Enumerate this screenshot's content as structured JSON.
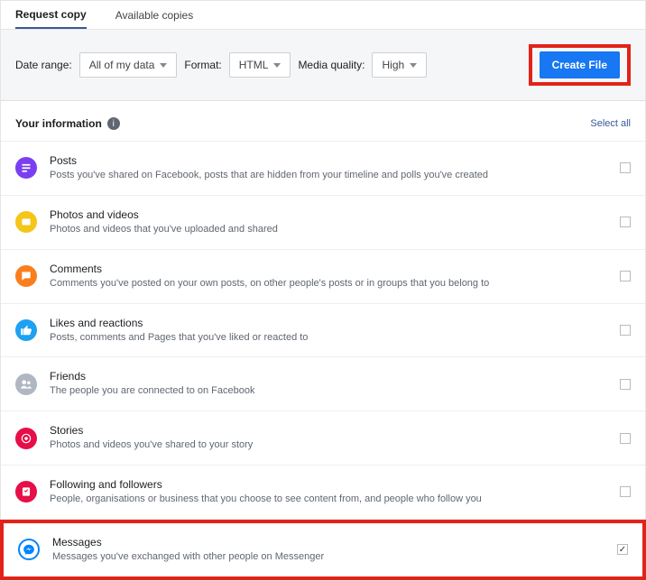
{
  "tabs": {
    "request": "Request copy",
    "available": "Available copies"
  },
  "filters": {
    "dateRangeLabel": "Date range:",
    "dateRangeValue": "All of my data",
    "formatLabel": "Format:",
    "formatValue": "HTML",
    "qualityLabel": "Media quality:",
    "qualityValue": "High",
    "createFile": "Create File"
  },
  "sectionTitle": "Your information",
  "selectAll": "Select all",
  "items": [
    {
      "label": "Posts",
      "desc": "Posts you've shared on Facebook, posts that are hidden from your timeline and polls you've created"
    },
    {
      "label": "Photos and videos",
      "desc": "Photos and videos that you've uploaded and shared"
    },
    {
      "label": "Comments",
      "desc": "Comments you've posted on your own posts, on other people's posts or in groups that you belong to"
    },
    {
      "label": "Likes and reactions",
      "desc": "Posts, comments and Pages that you've liked or reacted to"
    },
    {
      "label": "Friends",
      "desc": "The people you are connected to on Facebook"
    },
    {
      "label": "Stories",
      "desc": "Photos and videos you've shared to your story"
    },
    {
      "label": "Following and followers",
      "desc": "People, organisations or business that you choose to see content from, and people who follow you"
    },
    {
      "label": "Messages",
      "desc": "Messages you've exchanged with other people on Messenger"
    }
  ]
}
